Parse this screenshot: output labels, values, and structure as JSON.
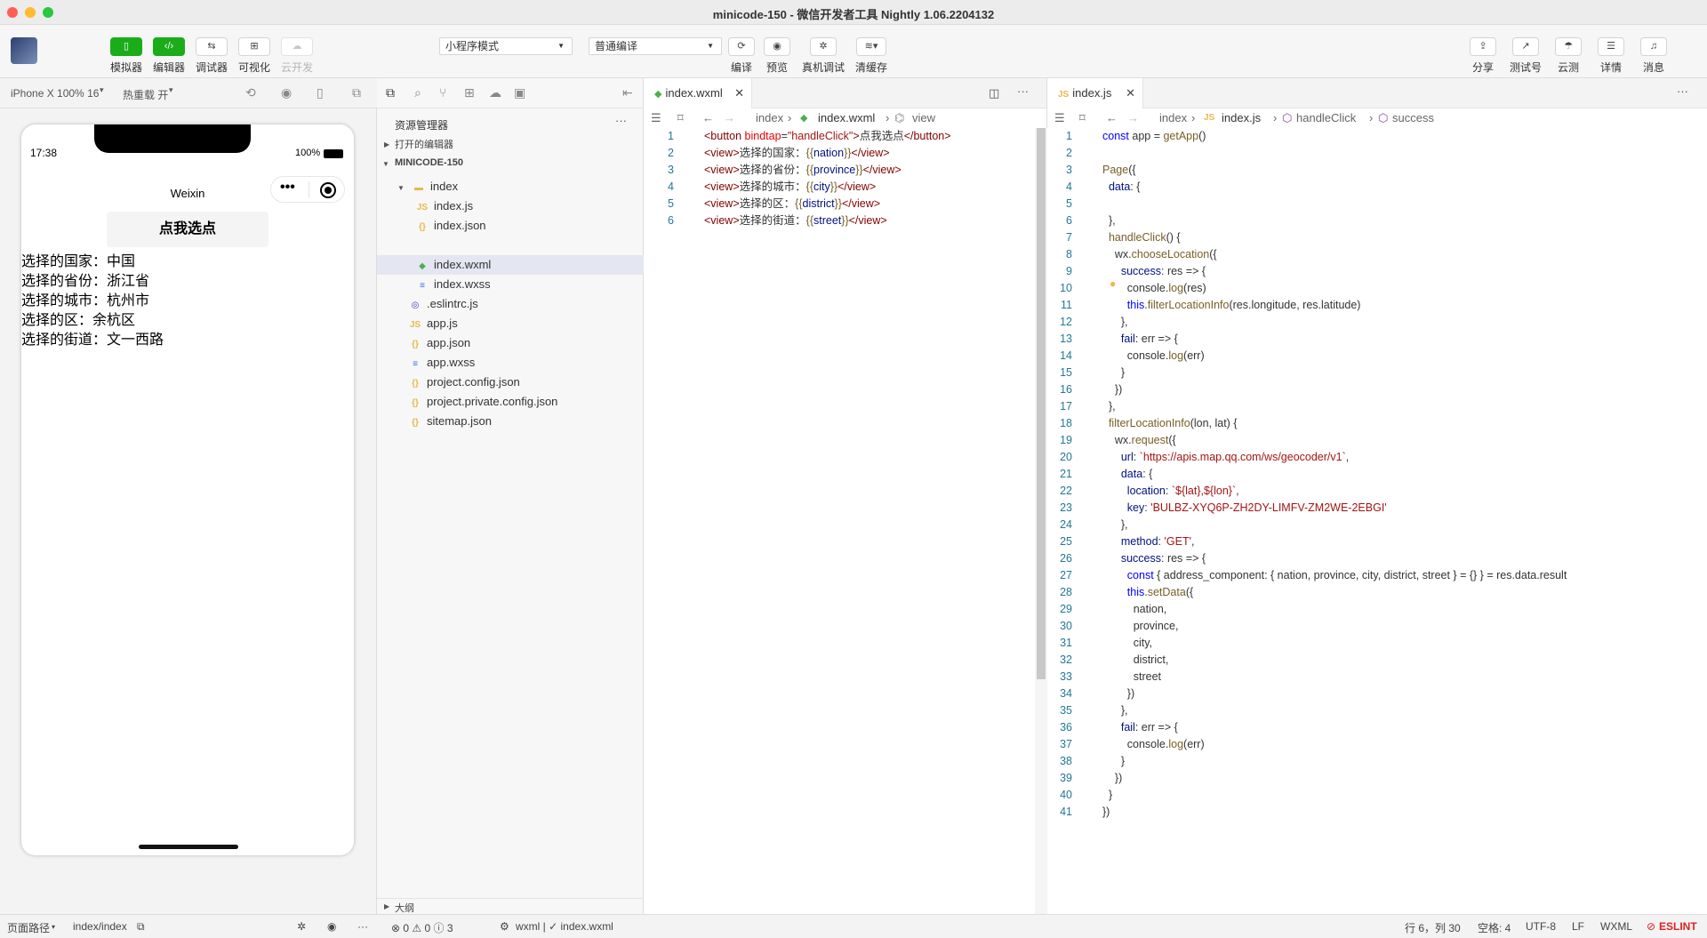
{
  "window": {
    "title": "minicode-150 - 微信开发者工具 Nightly 1.06.2204132"
  },
  "toolbar": {
    "left_buttons": [
      {
        "label": "模拟器",
        "icon": "phone-icon"
      },
      {
        "label": "编辑器",
        "icon": "code-icon"
      },
      {
        "label": "调试器",
        "icon": "debug-icon"
      },
      {
        "label": "可视化",
        "icon": "layout-icon"
      },
      {
        "label": "云开发",
        "icon": "cloud-icon"
      }
    ],
    "mode_select": "小程序模式",
    "compile_select": "普通编译",
    "center_buttons": [
      {
        "label": "编译",
        "icon": "refresh-icon"
      },
      {
        "label": "预览",
        "icon": "eye-icon"
      },
      {
        "label": "真机调试",
        "icon": "bug-icon"
      },
      {
        "label": "清缓存",
        "icon": "layers-icon"
      }
    ],
    "right_buttons": [
      {
        "label": "分享",
        "icon": "share-icon"
      },
      {
        "label": "测试号",
        "icon": "external-icon"
      },
      {
        "label": "云测",
        "icon": "cloud-test-icon"
      },
      {
        "label": "详情",
        "icon": "menu-icon"
      },
      {
        "label": "消息",
        "icon": "bell-icon"
      }
    ]
  },
  "simulator": {
    "device": "iPhone X 100% 16",
    "hot_reload": "热重载 开",
    "time": "17:38",
    "battery": "100%",
    "nav_title": "Weixin",
    "button_label": "点我选点",
    "results": [
      "选择的国家：中国",
      "选择的省份：浙江省",
      "选择的城市：杭州市",
      "选择的区：余杭区",
      "选择的街道：文一西路"
    ]
  },
  "explorer": {
    "title": "资源管理器",
    "open_editors": "打开的编辑器",
    "project": "MINICODE-150",
    "outline": "大纲",
    "files": [
      {
        "name": "index",
        "type": "folder"
      },
      {
        "name": "index.js",
        "type": "js"
      },
      {
        "name": "index.json",
        "type": "json"
      },
      {
        "name": "index.wxml",
        "type": "wxml"
      },
      {
        "name": "index.wxss",
        "type": "wxss"
      },
      {
        "name": ".eslintrc.js",
        "type": "eslint"
      },
      {
        "name": "app.js",
        "type": "js"
      },
      {
        "name": "app.json",
        "type": "json"
      },
      {
        "name": "app.wxss",
        "type": "wxss"
      },
      {
        "name": "project.config.json",
        "type": "json"
      },
      {
        "name": "project.private.config.json",
        "type": "json"
      },
      {
        "name": "sitemap.json",
        "type": "json"
      }
    ]
  },
  "editor1": {
    "tab": "index.wxml",
    "breadcrumb": [
      "index",
      "index.wxml",
      "view"
    ],
    "lines": [
      "<button bindtap=\"handleClick\">点我选点</button>",
      "<view>选择的国家：{{nation}}</view>",
      "<view>选择的省份：{{province}}</view>",
      "<view>选择的城市：{{city}}</view>",
      "<view>选择的区：{{district}}</view>",
      "<view>选择的街道：{{street}}</view>"
    ]
  },
  "editor2": {
    "tab": "index.js",
    "breadcrumb": [
      "index",
      "index.js",
      "handleClick",
      "success"
    ],
    "lines": [
      "const app = getApp()",
      "",
      "Page({",
      "  data: {",
      "",
      "  },",
      "  handleClick() {",
      "    wx.chooseLocation({",
      "      success: res => {",
      "        console.log(res)",
      "        this.filterLocationInfo(res.longitude, res.latitude)",
      "      },",
      "      fail: err => {",
      "        console.log(err)",
      "      }",
      "    })",
      "  },",
      "  filterLocationInfo(lon, lat) {",
      "    wx.request({",
      "      url: `https://apis.map.qq.com/ws/geocoder/v1`,",
      "      data: {",
      "        location: `${lat},${lon}`,",
      "        key: 'BULBZ-XYQ6P-ZH2DY-LIMFV-ZM2WE-2EBGI'",
      "      },",
      "      method: 'GET',",
      "      success: res => {",
      "        const { address_component: { nation, province, city, district, street } = {} } = res.data.result",
      "        this.setData({",
      "          nation,",
      "          province,",
      "          city,",
      "          district,",
      "          street",
      "        })",
      "      },",
      "      fail: err => {",
      "        console.log(err)",
      "      }",
      "    })",
      "  }",
      "})"
    ]
  },
  "statusbar": {
    "page_path_label": "页面路径",
    "page_path": "index/index",
    "problems": "⊗ 0 ⚠ 0 ⓘ 3",
    "file_info": "wxml | ✓ index.wxml",
    "cursor": "行 6，列 30",
    "indent": "空格: 4",
    "encoding": "UTF-8",
    "eol": "LF",
    "language": "WXML",
    "eslint": "ESLINT"
  },
  "colors": {
    "accent_green": "#1aad19",
    "eslint_red": "#e02020"
  }
}
